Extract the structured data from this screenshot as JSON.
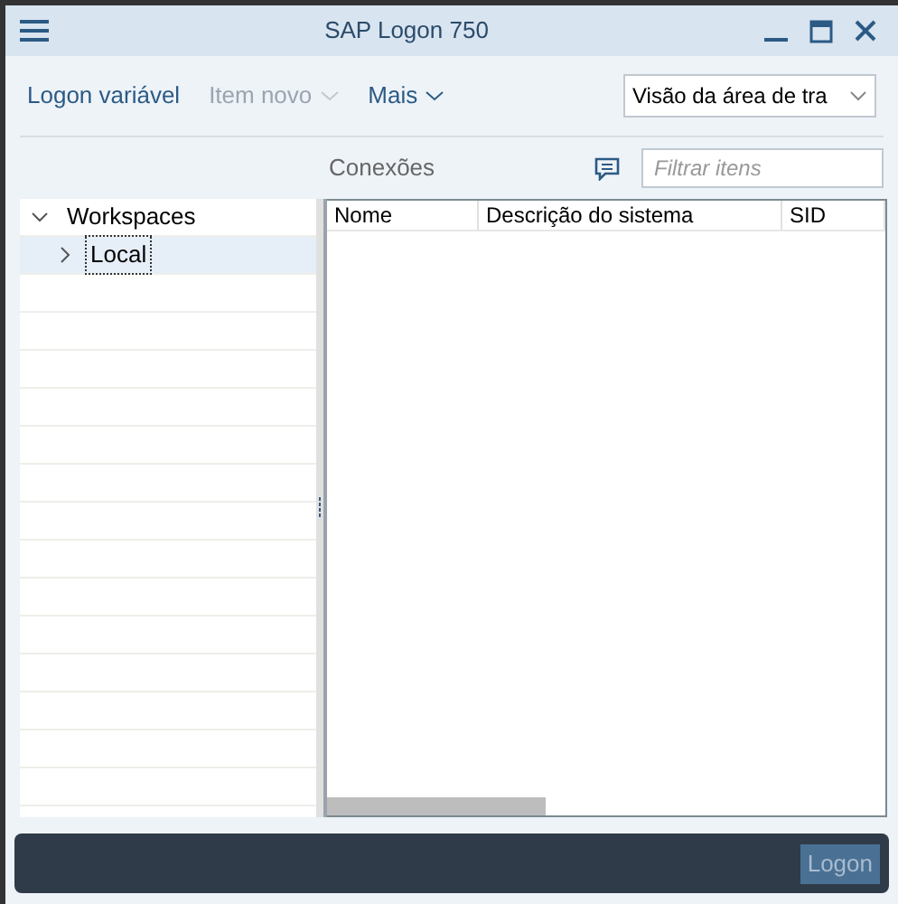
{
  "window": {
    "title": "SAP Logon 750"
  },
  "toolbar": {
    "items": [
      {
        "label": "Logon variável",
        "disabled": false,
        "kind": "link"
      },
      {
        "label": "Item novo",
        "disabled": true,
        "kind": "menu"
      },
      {
        "label": "Mais",
        "disabled": false,
        "kind": "menu"
      }
    ],
    "view_select": {
      "value": "Visão da área de tra"
    }
  },
  "connections": {
    "label": "Conexões",
    "filter": {
      "placeholder": "Filtrar itens"
    }
  },
  "tree": [
    {
      "label": "Workspaces",
      "expanded": true,
      "selected": false,
      "children": [
        {
          "label": "Local",
          "expanded": false,
          "selected": true
        }
      ]
    }
  ],
  "table": {
    "columns": [
      "Nome",
      "Descrição do sistema",
      "SID"
    ]
  },
  "footer": {
    "logon_button": {
      "label": "Logon",
      "disabled": true
    }
  }
}
